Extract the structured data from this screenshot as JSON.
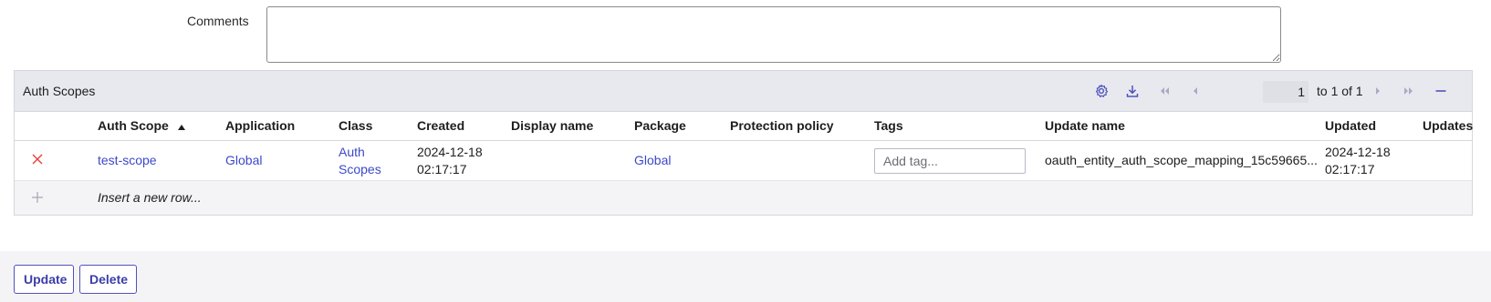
{
  "form": {
    "comments_label": "Comments",
    "comments_value": ""
  },
  "related_list": {
    "title": "Auth Scopes",
    "pagination": {
      "current_page_input": "1",
      "range_text": "to 1 of 1"
    },
    "columns": [
      {
        "label": "Auth Scope",
        "sorted": "ascending"
      },
      {
        "label": "Application"
      },
      {
        "label": "Class"
      },
      {
        "label": "Created"
      },
      {
        "label": "Display name"
      },
      {
        "label": "Package"
      },
      {
        "label": "Protection policy"
      },
      {
        "label": "Tags"
      },
      {
        "label": "Update name"
      },
      {
        "label": "Updated"
      },
      {
        "label": "Updates"
      }
    ],
    "rows": [
      {
        "auth_scope": "test-scope",
        "application": "Global",
        "class_line1": "Auth",
        "class_line2": "Scopes",
        "created_date": "2024-12-18",
        "created_time": "02:17:17",
        "display_name": "",
        "package": "Global",
        "protection_policy": "",
        "tags_placeholder": "Add tag...",
        "update_name": "oauth_entity_auth_scope_mapping_15c59665...",
        "updated_date": "2024-12-18",
        "updated_time": "02:17:17",
        "updates": ""
      }
    ],
    "insert_row_label": "Insert a new row..."
  },
  "footer": {
    "update_label": "Update",
    "delete_label": "Delete"
  },
  "colors": {
    "accent": "#4f52bd",
    "link": "#3c48c9",
    "delete_x": "#e8403a",
    "header_bg": "#e8e9ee"
  },
  "icons": {
    "row_delete": "close-icon",
    "insert": "plus-icon",
    "settings": "gear-icon",
    "export": "download-icon",
    "first": "double-chevron-left-icon",
    "prev": "chevron-left-icon",
    "next": "chevron-right-icon",
    "last": "double-chevron-right-icon",
    "collapse": "minus-icon",
    "sort": "sort-ascending-icon"
  }
}
